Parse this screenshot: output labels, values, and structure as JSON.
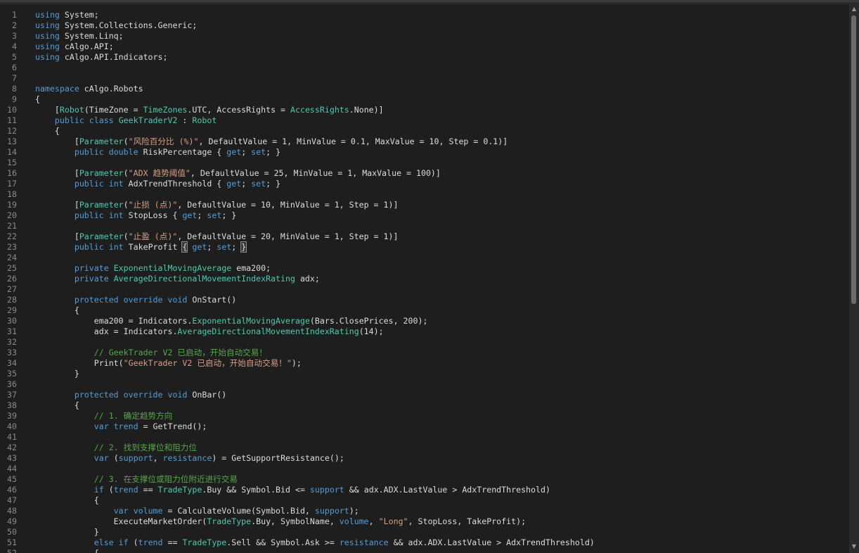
{
  "editor": {
    "lines": [
      {
        "n": "1",
        "t": [
          [
            "kw",
            "using"
          ],
          [
            "txt",
            " System;"
          ]
        ]
      },
      {
        "n": "2",
        "t": [
          [
            "kw",
            "using"
          ],
          [
            "txt",
            " System.Collections.Generic;"
          ]
        ]
      },
      {
        "n": "3",
        "t": [
          [
            "kw",
            "using"
          ],
          [
            "txt",
            " System.Linq;"
          ]
        ]
      },
      {
        "n": "4",
        "t": [
          [
            "kw",
            "using"
          ],
          [
            "txt",
            " cAlgo.API;"
          ]
        ]
      },
      {
        "n": "5",
        "t": [
          [
            "kw",
            "using"
          ],
          [
            "txt",
            " cAlgo.API.Indicators;"
          ]
        ]
      },
      {
        "n": "6",
        "t": []
      },
      {
        "n": "7",
        "t": []
      },
      {
        "n": "8",
        "t": [
          [
            "kw",
            "namespace"
          ],
          [
            "txt",
            " cAlgo.Robots"
          ]
        ]
      },
      {
        "n": "9",
        "t": [
          [
            "txt",
            "{"
          ]
        ]
      },
      {
        "n": "10",
        "t": [
          [
            "txt",
            "    ["
          ],
          [
            "ty",
            "Robot"
          ],
          [
            "txt",
            "(TimeZone = "
          ],
          [
            "ty",
            "TimeZones"
          ],
          [
            "txt",
            ".UTC, AccessRights = "
          ],
          [
            "ty",
            "AccessRights"
          ],
          [
            "txt",
            ".None)]"
          ]
        ]
      },
      {
        "n": "11",
        "t": [
          [
            "txt",
            "    "
          ],
          [
            "kw",
            "public"
          ],
          [
            "txt",
            " "
          ],
          [
            "kw",
            "class"
          ],
          [
            "txt",
            " "
          ],
          [
            "ty",
            "GeekTraderV2"
          ],
          [
            "txt",
            " : "
          ],
          [
            "ty",
            "Robot"
          ]
        ]
      },
      {
        "n": "12",
        "t": [
          [
            "txt",
            "    {"
          ]
        ]
      },
      {
        "n": "13",
        "t": [
          [
            "txt",
            "        ["
          ],
          [
            "ty",
            "Parameter"
          ],
          [
            "txt",
            "("
          ],
          [
            "str",
            "\"风险百分比 (%)\""
          ],
          [
            "txt",
            ", DefaultValue = 1, MinValue = 0.1, MaxValue = 10, Step = 0.1)]"
          ]
        ]
      },
      {
        "n": "14",
        "t": [
          [
            "txt",
            "        "
          ],
          [
            "kw",
            "public"
          ],
          [
            "txt",
            " "
          ],
          [
            "kw",
            "double"
          ],
          [
            "txt",
            " RiskPercentage { "
          ],
          [
            "kw",
            "get"
          ],
          [
            "txt",
            "; "
          ],
          [
            "kw",
            "set"
          ],
          [
            "txt",
            "; }"
          ]
        ]
      },
      {
        "n": "15",
        "t": []
      },
      {
        "n": "16",
        "t": [
          [
            "txt",
            "        ["
          ],
          [
            "ty",
            "Parameter"
          ],
          [
            "txt",
            "("
          ],
          [
            "str",
            "\"ADX 趋势阈值\""
          ],
          [
            "txt",
            ", DefaultValue = 25, MinValue = 1, MaxValue = 100)]"
          ]
        ]
      },
      {
        "n": "17",
        "t": [
          [
            "txt",
            "        "
          ],
          [
            "kw",
            "public"
          ],
          [
            "txt",
            " "
          ],
          [
            "kw",
            "int"
          ],
          [
            "txt",
            " AdxTrendThreshold { "
          ],
          [
            "kw",
            "get"
          ],
          [
            "txt",
            "; "
          ],
          [
            "kw",
            "set"
          ],
          [
            "txt",
            "; }"
          ]
        ]
      },
      {
        "n": "18",
        "t": []
      },
      {
        "n": "19",
        "t": [
          [
            "txt",
            "        ["
          ],
          [
            "ty",
            "Parameter"
          ],
          [
            "txt",
            "("
          ],
          [
            "str",
            "\"止损 (点)\""
          ],
          [
            "txt",
            ", DefaultValue = 10, MinValue = 1, Step = 1)]"
          ]
        ]
      },
      {
        "n": "20",
        "t": [
          [
            "txt",
            "        "
          ],
          [
            "kw",
            "public"
          ],
          [
            "txt",
            " "
          ],
          [
            "kw",
            "int"
          ],
          [
            "txt",
            " StopLoss { "
          ],
          [
            "kw",
            "get"
          ],
          [
            "txt",
            "; "
          ],
          [
            "kw",
            "set"
          ],
          [
            "txt",
            "; }"
          ]
        ]
      },
      {
        "n": "21",
        "t": []
      },
      {
        "n": "22",
        "t": [
          [
            "txt",
            "        ["
          ],
          [
            "ty",
            "Parameter"
          ],
          [
            "txt",
            "("
          ],
          [
            "str",
            "\"止盈 (点)\""
          ],
          [
            "txt",
            ", DefaultValue = 20, MinValue = 1, Step = 1)]"
          ]
        ]
      },
      {
        "n": "23",
        "t": [
          [
            "txt",
            "        "
          ],
          [
            "kw",
            "public"
          ],
          [
            "txt",
            " "
          ],
          [
            "kw",
            "int"
          ],
          [
            "txt",
            " TakeProfit "
          ],
          [
            "hl",
            "{"
          ],
          [
            "txt",
            " "
          ],
          [
            "kw",
            "get"
          ],
          [
            "txt",
            "; "
          ],
          [
            "kw",
            "set"
          ],
          [
            "txt",
            "; "
          ],
          [
            "hl",
            "}"
          ]
        ]
      },
      {
        "n": "24",
        "t": []
      },
      {
        "n": "25",
        "t": [
          [
            "txt",
            "        "
          ],
          [
            "kw",
            "private"
          ],
          [
            "txt",
            " "
          ],
          [
            "ty",
            "ExponentialMovingAverage"
          ],
          [
            "txt",
            " ema200;"
          ]
        ]
      },
      {
        "n": "26",
        "t": [
          [
            "txt",
            "        "
          ],
          [
            "kw",
            "private"
          ],
          [
            "txt",
            " "
          ],
          [
            "ty",
            "AverageDirectionalMovementIndexRating"
          ],
          [
            "txt",
            " adx;"
          ]
        ]
      },
      {
        "n": "27",
        "t": []
      },
      {
        "n": "28",
        "t": [
          [
            "txt",
            "        "
          ],
          [
            "kw",
            "protected"
          ],
          [
            "txt",
            " "
          ],
          [
            "kw",
            "override"
          ],
          [
            "txt",
            " "
          ],
          [
            "kw",
            "void"
          ],
          [
            "txt",
            " OnStart()"
          ]
        ]
      },
      {
        "n": "29",
        "t": [
          [
            "txt",
            "        {"
          ]
        ]
      },
      {
        "n": "30",
        "t": [
          [
            "txt",
            "            ema200 = Indicators."
          ],
          [
            "ty",
            "ExponentialMovingAverage"
          ],
          [
            "txt",
            "(Bars.ClosePrices, 200);"
          ]
        ]
      },
      {
        "n": "31",
        "t": [
          [
            "txt",
            "            adx = Indicators."
          ],
          [
            "ty",
            "AverageDirectionalMovementIndexRating"
          ],
          [
            "txt",
            "(14);"
          ]
        ]
      },
      {
        "n": "32",
        "t": []
      },
      {
        "n": "33",
        "t": [
          [
            "txt",
            "            "
          ],
          [
            "cm",
            "// GeekTrader V2 已启动，开始自动交易！"
          ]
        ]
      },
      {
        "n": "34",
        "t": [
          [
            "txt",
            "            Print("
          ],
          [
            "str",
            "\"GeekTrader V2 已启动，开始自动交易！\""
          ],
          [
            "txt",
            ");"
          ]
        ]
      },
      {
        "n": "35",
        "t": [
          [
            "txt",
            "        }"
          ]
        ]
      },
      {
        "n": "36",
        "t": []
      },
      {
        "n": "37",
        "t": [
          [
            "txt",
            "        "
          ],
          [
            "kw",
            "protected"
          ],
          [
            "txt",
            " "
          ],
          [
            "kw",
            "override"
          ],
          [
            "txt",
            " "
          ],
          [
            "kw",
            "void"
          ],
          [
            "txt",
            " OnBar()"
          ]
        ]
      },
      {
        "n": "38",
        "t": [
          [
            "txt",
            "        {"
          ]
        ]
      },
      {
        "n": "39",
        "t": [
          [
            "txt",
            "            "
          ],
          [
            "cm",
            "// 1. 确定趋势方向"
          ]
        ]
      },
      {
        "n": "40",
        "t": [
          [
            "txt",
            "            "
          ],
          [
            "kw",
            "var"
          ],
          [
            "txt",
            " "
          ],
          [
            "kw",
            "trend"
          ],
          [
            "txt",
            " = GetTrend();"
          ]
        ]
      },
      {
        "n": "41",
        "t": []
      },
      {
        "n": "42",
        "t": [
          [
            "txt",
            "            "
          ],
          [
            "cm",
            "// 2. 找到支撑位和阻力位"
          ]
        ]
      },
      {
        "n": "43",
        "t": [
          [
            "txt",
            "            "
          ],
          [
            "kw",
            "var"
          ],
          [
            "txt",
            " ("
          ],
          [
            "kw",
            "support"
          ],
          [
            "txt",
            ", "
          ],
          [
            "kw",
            "resistance"
          ],
          [
            "txt",
            ") = GetSupportResistance();"
          ]
        ]
      },
      {
        "n": "44",
        "t": []
      },
      {
        "n": "45",
        "t": [
          [
            "txt",
            "            "
          ],
          [
            "cm",
            "// 3. 在支撑位或阻力位附近进行交易"
          ]
        ]
      },
      {
        "n": "46",
        "t": [
          [
            "txt",
            "            "
          ],
          [
            "kw",
            "if"
          ],
          [
            "txt",
            " ("
          ],
          [
            "kw",
            "trend"
          ],
          [
            "txt",
            " == "
          ],
          [
            "ty",
            "TradeType"
          ],
          [
            "txt",
            ".Buy && Symbol.Bid <= "
          ],
          [
            "kw",
            "support"
          ],
          [
            "txt",
            " && adx.ADX.LastValue > AdxTrendThreshold)"
          ]
        ]
      },
      {
        "n": "47",
        "t": [
          [
            "txt",
            "            {"
          ]
        ]
      },
      {
        "n": "48",
        "t": [
          [
            "txt",
            "                "
          ],
          [
            "kw",
            "var"
          ],
          [
            "txt",
            " "
          ],
          [
            "kw",
            "volume"
          ],
          [
            "txt",
            " = CalculateVolume(Symbol.Bid, "
          ],
          [
            "kw",
            "support"
          ],
          [
            "txt",
            ");"
          ]
        ]
      },
      {
        "n": "49",
        "t": [
          [
            "txt",
            "                ExecuteMarketOrder("
          ],
          [
            "ty",
            "TradeType"
          ],
          [
            "txt",
            ".Buy, SymbolName, "
          ],
          [
            "kw",
            "volume"
          ],
          [
            "txt",
            ", "
          ],
          [
            "str",
            "\"Long\""
          ],
          [
            "txt",
            ", StopLoss, TakeProfit);"
          ]
        ]
      },
      {
        "n": "50",
        "t": [
          [
            "txt",
            "            }"
          ]
        ]
      },
      {
        "n": "51",
        "t": [
          [
            "txt",
            "            "
          ],
          [
            "kw",
            "else"
          ],
          [
            "txt",
            " "
          ],
          [
            "kw",
            "if"
          ],
          [
            "txt",
            " ("
          ],
          [
            "kw",
            "trend"
          ],
          [
            "txt",
            " == "
          ],
          [
            "ty",
            "TradeType"
          ],
          [
            "txt",
            ".Sell && Symbol.Ask >= "
          ],
          [
            "kw",
            "resistance"
          ],
          [
            "txt",
            " && adx.ADX.LastValue > AdxTrendThreshold)"
          ]
        ]
      },
      {
        "n": "52",
        "t": [
          [
            "txt",
            "            {"
          ]
        ]
      }
    ]
  },
  "scrollbar": {
    "up_icon": "triangle-up-icon",
    "down_icon": "triangle-down-icon",
    "up_glyph": "▲",
    "down_glyph": "▼"
  },
  "colors": {
    "keyword": "#569cd6",
    "type": "#4ec9b0",
    "string": "#d69d85",
    "comment": "#57a64a",
    "text": "#dcdcdc",
    "background": "#1e1e1e",
    "gutter": "#8a8a8a"
  }
}
